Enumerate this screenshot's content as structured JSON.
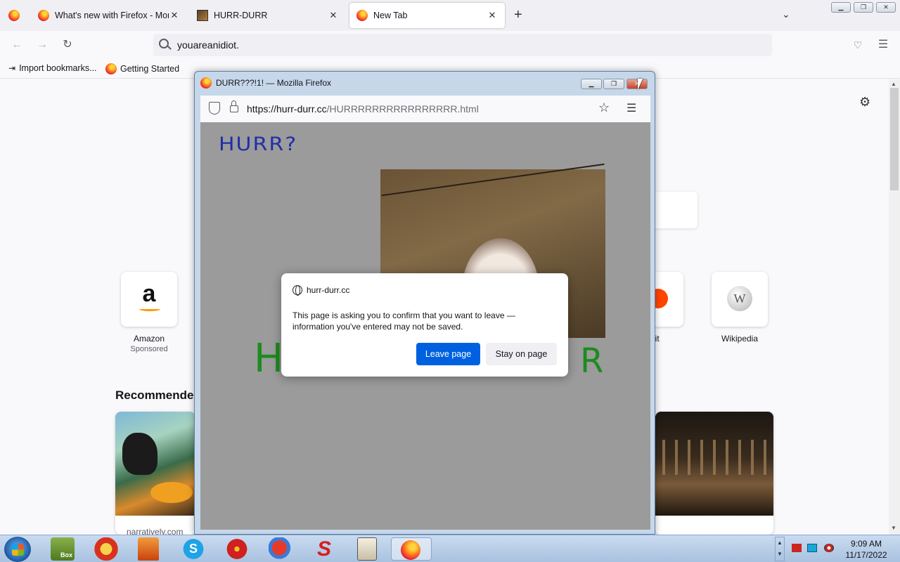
{
  "tabs": [
    {
      "title": "What's new with Firefox - More",
      "favicon": "firefox-icon"
    },
    {
      "title": "HURR-DURR",
      "favicon": "dog-photo-icon"
    },
    {
      "title": "New Tab",
      "favicon": "firefox-icon",
      "active": true
    }
  ],
  "url_value": "youareanidiot.",
  "bookmarks": [
    {
      "label": "Import bookmarks..."
    },
    {
      "label": "Getting Started"
    }
  ],
  "shortcuts": [
    {
      "label": "Amazon",
      "sublabel": "Sponsored",
      "glyph": "a"
    },
    {
      "label": "ddit",
      "glyph": ""
    },
    {
      "label": "Wikipedia",
      "glyph": "W"
    }
  ],
  "section_heading": "Recommendec",
  "card_source": "narratively.com",
  "popup": {
    "title": "DURR???!1! — Mozilla Firefox",
    "url_host": "https://hurr-durr.cc",
    "url_path": "/HURRRRRRRRRRRRRRRR.html",
    "heading_text": "HURR?",
    "big_left": "H",
    "big_right": "R"
  },
  "dialog": {
    "host": "hurr-durr.cc",
    "message": "This page is asking you to confirm that you want to leave — information you've entered may not be saved.",
    "leave_label": "Leave page",
    "stay_label": "Stay on page"
  },
  "taskbar": {
    "time": "9:09 AM",
    "date": "11/17/2022",
    "box_label": "Box"
  },
  "colors": {
    "accent": "#0061e0",
    "popup_page_bg": "#9b9b9b",
    "hurr_blue": "#1f2fa8",
    "hurr_green": "#1e8b1e"
  }
}
